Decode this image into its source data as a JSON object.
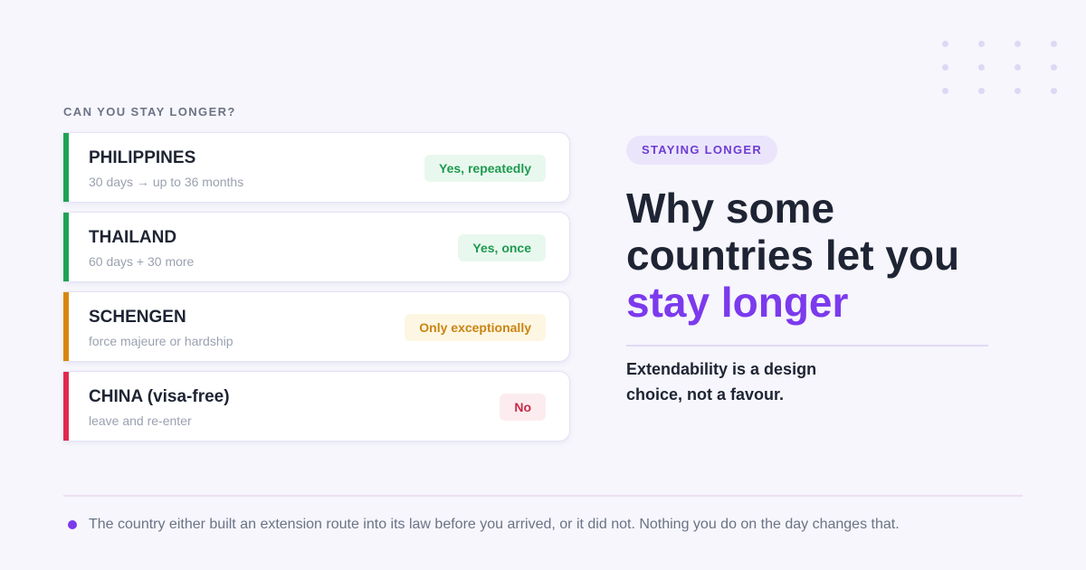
{
  "section_label": "CAN YOU STAY LONGER?",
  "cards": [
    {
      "name": "PHILIPPINES",
      "detail": "30 days → up to 36 months",
      "badge": "Yes, repeatedly",
      "status": "yes",
      "accent": "#1fa355"
    },
    {
      "name": "THAILAND",
      "detail": "60 days + 30 more",
      "badge": "Yes, once",
      "status": "yes",
      "accent": "#1fa355"
    },
    {
      "name": "SCHENGEN",
      "detail": "force majeure or hardship",
      "badge": "Only exceptionally",
      "status": "warn",
      "accent": "#d9860f"
    },
    {
      "name": "CHINA (visa-free)",
      "detail": "leave and re-enter",
      "badge": "No",
      "status": "no",
      "accent": "#e0294f"
    }
  ],
  "tag": "STAYING LONGER",
  "headline": {
    "line1": "Why some",
    "line2": "countries let you",
    "highlight": "stay longer"
  },
  "subline": "Extendability is a design choice, not a favour.",
  "footer_note": "The country either built an extension route into its law before you arrived, or it did not. Nothing you do on the day changes that.",
  "colors": {
    "accent_purple": "#7c3aed",
    "yes_green": "#1f9a50",
    "warn_amber": "#c98512",
    "no_red": "#c72a48"
  }
}
